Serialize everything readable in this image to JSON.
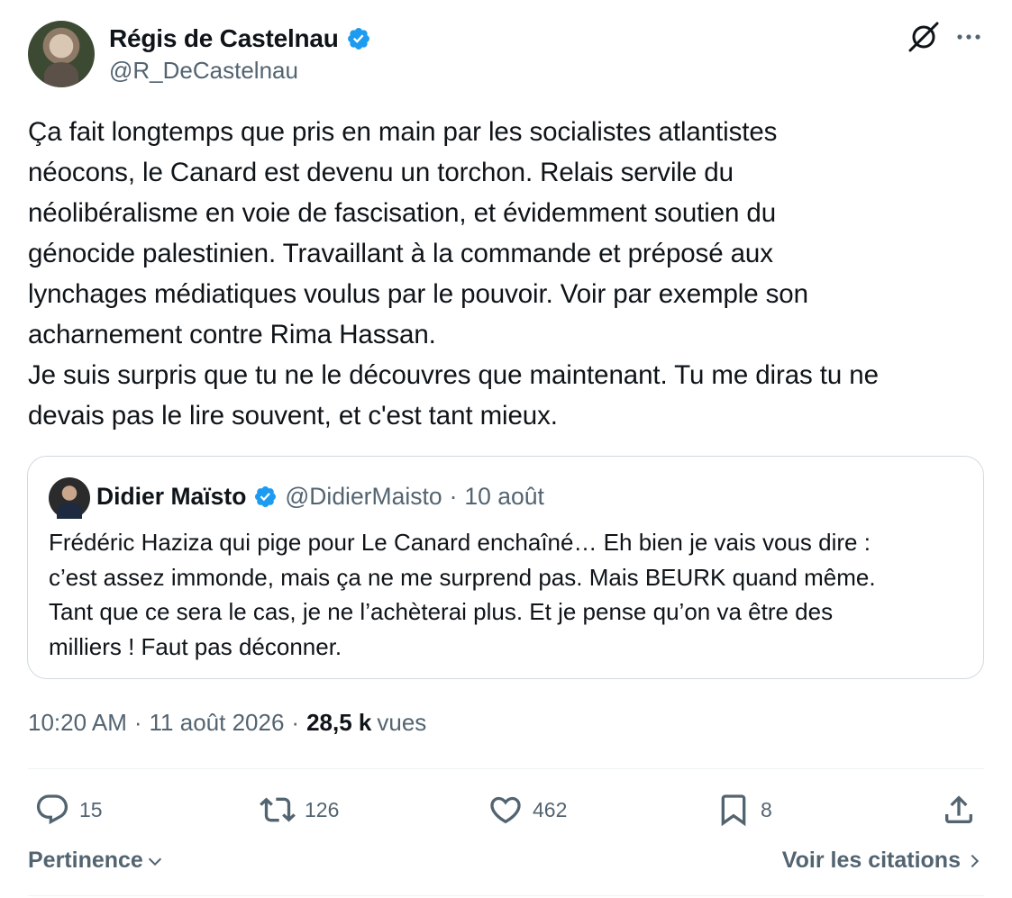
{
  "author": {
    "name": "Régis de Castelnau",
    "handle": "@R_DeCastelnau",
    "verified": true
  },
  "tweet": {
    "lines": [
      "Ça fait longtemps que pris en main par les socialistes atlantistes",
      "néocons, le Canard est devenu un torchon. Relais servile du",
      "néolibéralisme en voie de fascisation, et évidemment soutien du",
      "génocide palestinien. Travaillant à la commande et préposé aux",
      "lynchages médiatiques voulus par le pouvoir. Voir par exemple son",
      "acharnement contre Rima Hassan.",
      "Je suis surpris que tu ne le découvres que maintenant. Tu me diras tu ne",
      "devais pas le lire souvent, et c'est tant mieux."
    ]
  },
  "quoted": {
    "name": "Didier Maïsto",
    "handle": "@DidierMaisto",
    "separator": "·",
    "date": "10 août",
    "verified": true,
    "lines": [
      "Frédéric Haziza qui pige pour Le Canard enchaîné… Eh bien je vais vous dire :",
      "c’est assez immonde, mais ça ne me surprend pas. Mais BEURK quand même.",
      "Tant que ce sera le cas, je ne l’achèterai plus. Et je pense qu’on va être des",
      "milliers ! Faut pas déconner."
    ]
  },
  "meta": {
    "time": "10:20 AM",
    "separator": "·",
    "date": "11 août 2026",
    "views_count": "28,5 k",
    "views_label": "vues"
  },
  "actions": {
    "replies": "15",
    "reposts": "126",
    "likes": "462",
    "bookmarks": "8"
  },
  "footer": {
    "sort_label": "Pertinence",
    "quotes_label": "Voir les citations"
  },
  "colors": {
    "verified": "#1d9bf0",
    "secondary_text": "#536471",
    "primary_text": "#0f1419",
    "border": "#cfd9de"
  },
  "icons": [
    "grok-icon",
    "more-icon",
    "reply-icon",
    "repost-icon",
    "like-icon",
    "bookmark-icon",
    "share-icon",
    "chevron-down-icon",
    "chevron-right-icon",
    "verified-badge-icon"
  ]
}
